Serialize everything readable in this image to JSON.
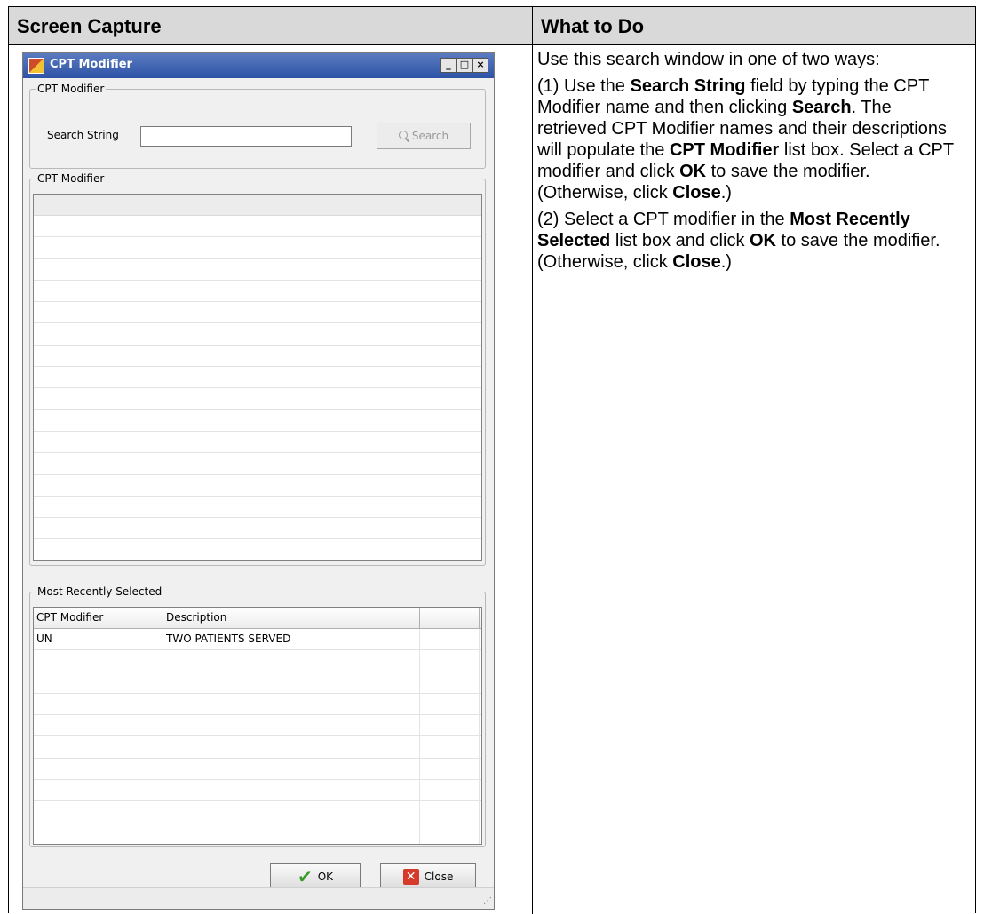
{
  "table": {
    "col1_header": "Screen Capture",
    "col2_header": "What to Do"
  },
  "instructions": {
    "p1": "Use this search window in one of two ways:",
    "p2": [
      {
        "t": "(1) Use the ",
        "b": false
      },
      {
        "t": "Search String",
        "b": true
      },
      {
        "t": " field by typing the CPT Modifier name and then clicking ",
        "b": false
      },
      {
        "t": "Search",
        "b": true
      },
      {
        "t": ". The retrieved CPT Modifier names and their descriptions will populate the ",
        "b": false
      },
      {
        "t": "CPT Modifier",
        "b": true
      },
      {
        "t": " list box. Select a CPT modifier and click ",
        "b": false
      },
      {
        "t": "OK",
        "b": true
      },
      {
        "t": " to save the modifier. (Otherwise, click ",
        "b": false
      },
      {
        "t": "Close",
        "b": true
      },
      {
        "t": ".)",
        "b": false
      }
    ],
    "p3": [
      {
        "t": "(2) Select a CPT modifier in the ",
        "b": false
      },
      {
        "t": "Most Recently Selected",
        "b": true
      },
      {
        "t": " list box and click ",
        "b": false
      },
      {
        "t": "OK",
        "b": true
      },
      {
        "t": " to save the modifier. (Otherwise, click ",
        "b": false
      },
      {
        "t": "Close",
        "b": true
      },
      {
        "t": ".)",
        "b": false
      }
    ]
  },
  "dialog": {
    "title": "CPT Modifier",
    "minimize": "_",
    "maximize": "□",
    "close": "×",
    "search_group": "CPT Modifier",
    "search_label": "Search String",
    "search_value": "",
    "search_button": "Search",
    "list_group": "CPT Modifier",
    "recent_group": "Most Recently Selected",
    "recent_columns": [
      "CPT Modifier",
      "Description",
      ""
    ],
    "recent_rows": [
      {
        "code": "UN",
        "desc": "TWO PATIENTS SERVED"
      }
    ],
    "ok_button": "OK",
    "close_button": "Close"
  }
}
